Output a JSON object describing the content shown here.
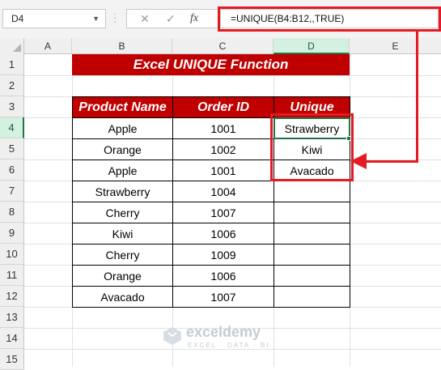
{
  "formula_bar": {
    "name_box": "D4",
    "cancel_symbol": "✕",
    "enter_symbol": "✓",
    "fx_symbol": "fx",
    "formula": "=UNIQUE(B4:B12,,TRUE)"
  },
  "columns": [
    "A",
    "B",
    "C",
    "D",
    "E"
  ],
  "rows": [
    "1",
    "2",
    "3",
    "4",
    "5",
    "6",
    "7",
    "8",
    "9",
    "10",
    "11",
    "12",
    "13",
    "14",
    "15"
  ],
  "sheet": {
    "title": "Excel UNIQUE Function",
    "headers": {
      "product": "Product Name",
      "order": "Order ID",
      "unique": "Unique"
    },
    "table": [
      {
        "product": "Apple",
        "order": "1001",
        "unique": "Strawberry"
      },
      {
        "product": "Orange",
        "order": "1002",
        "unique": "Kiwi"
      },
      {
        "product": "Apple",
        "order": "1001",
        "unique": "Avacado"
      },
      {
        "product": "Strawberry",
        "order": "1004",
        "unique": ""
      },
      {
        "product": "Cherry",
        "order": "1007",
        "unique": ""
      },
      {
        "product": "Kiwi",
        "order": "1006",
        "unique": ""
      },
      {
        "product": "Cherry",
        "order": "1009",
        "unique": ""
      },
      {
        "product": "Orange",
        "order": "1006",
        "unique": ""
      },
      {
        "product": "Avacado",
        "order": "1007",
        "unique": ""
      }
    ]
  },
  "watermark": {
    "name": "exceldemy",
    "tagline": "EXCEL · DATA · BI"
  },
  "colors": {
    "header_red": "#c00000",
    "annotation_red": "#e31b23",
    "selection_green": "#217346"
  }
}
